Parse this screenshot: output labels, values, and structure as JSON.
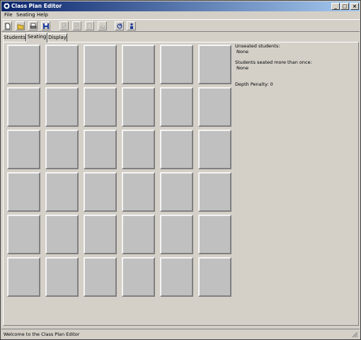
{
  "window": {
    "title": "Class Plan Editor"
  },
  "menu": [
    "File",
    "Seating",
    "Help"
  ],
  "toolbar": [
    {
      "icon": "new-document-icon",
      "enabled": true
    },
    {
      "icon": "open-folder-icon",
      "enabled": true
    },
    {
      "icon": "print-icon",
      "enabled": true
    },
    {
      "icon": "save-icon",
      "enabled": true
    },
    {
      "icon": "edit-icon",
      "enabled": false
    },
    {
      "icon": "edit-seat-icon",
      "enabled": false
    },
    {
      "icon": "blank-document-icon",
      "enabled": false
    },
    {
      "icon": "chart-icon",
      "enabled": false
    },
    {
      "icon": "refresh-icon",
      "enabled": true
    },
    {
      "icon": "person-icon",
      "enabled": true
    }
  ],
  "tabs": [
    {
      "label": "Students",
      "active": false
    },
    {
      "label": "Seating",
      "active": true
    },
    {
      "label": "Display",
      "active": false
    }
  ],
  "seating": {
    "rows": 6,
    "cols": 6
  },
  "info": {
    "unseated_label": "Unseated students:",
    "unseated_value": "None",
    "multi_label": "Students seated more than once:",
    "multi_value": "None",
    "depth_penalty": "Depth Penalty: 0"
  },
  "status": "Welcome to the Class Plan Editor"
}
